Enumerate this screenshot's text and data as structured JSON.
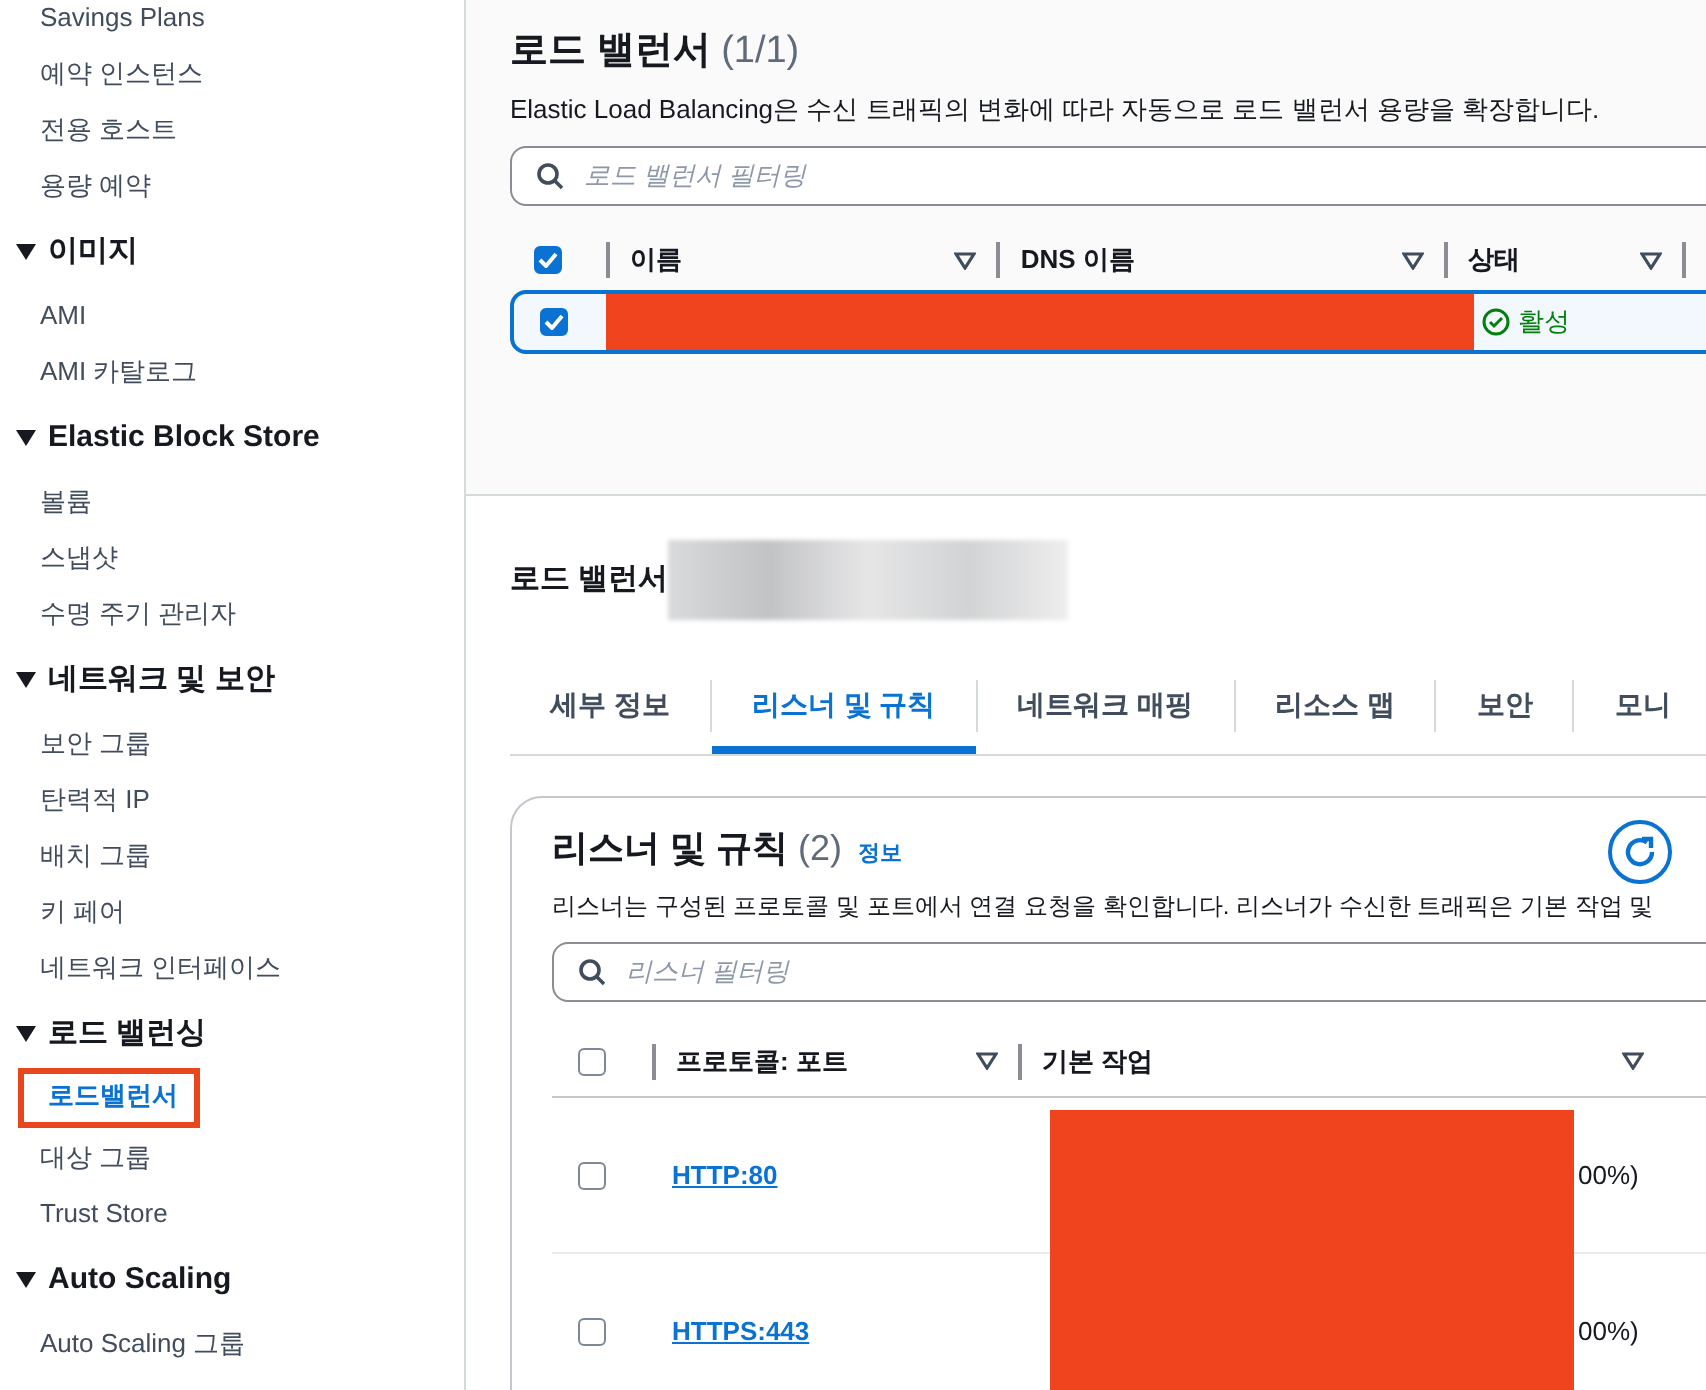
{
  "sidebar": {
    "items": [
      {
        "kind": "item",
        "label": "Savings Plans",
        "selected": false
      },
      {
        "kind": "item",
        "label": "예약 인스턴스",
        "selected": false
      },
      {
        "kind": "item",
        "label": "전용 호스트",
        "selected": false
      },
      {
        "kind": "item",
        "label": "용량 예약",
        "selected": false
      },
      {
        "kind": "header",
        "label": "이미지",
        "expanded": true
      },
      {
        "kind": "item",
        "label": "AMI",
        "selected": false
      },
      {
        "kind": "item",
        "label": "AMI 카탈로그",
        "selected": false
      },
      {
        "kind": "header",
        "label": "Elastic Block Store",
        "expanded": true
      },
      {
        "kind": "item",
        "label": "볼륨",
        "selected": false
      },
      {
        "kind": "item",
        "label": "스냅샷",
        "selected": false
      },
      {
        "kind": "item",
        "label": "수명 주기 관리자",
        "selected": false
      },
      {
        "kind": "header",
        "label": "네트워크 및 보안",
        "expanded": true
      },
      {
        "kind": "item",
        "label": "보안 그룹",
        "selected": false
      },
      {
        "kind": "item",
        "label": "탄력적 IP",
        "selected": false
      },
      {
        "kind": "item",
        "label": "배치 그룹",
        "selected": false
      },
      {
        "kind": "item",
        "label": "키 페어",
        "selected": false
      },
      {
        "kind": "item",
        "label": "네트워크 인터페이스",
        "selected": false
      },
      {
        "kind": "header",
        "label": "로드 밸런싱",
        "expanded": true
      },
      {
        "kind": "item",
        "label": "로드밸런서",
        "selected": true
      },
      {
        "kind": "item",
        "label": "대상 그룹",
        "selected": false
      },
      {
        "kind": "item",
        "label": "Trust Store",
        "selected": false
      },
      {
        "kind": "header",
        "label": "Auto Scaling",
        "expanded": true
      },
      {
        "kind": "item",
        "label": "Auto Scaling 그룹",
        "selected": false
      }
    ]
  },
  "load_balancers": {
    "title": "로드 밸런서",
    "count": "(1/1)",
    "description": "Elastic Load Balancing은 수신 트래픽의 변화에 따라 자동으로 로드 밸런서 용량을 확장합니다.",
    "filter": {
      "placeholder": "로드 밸런서 필터링"
    },
    "table": {
      "all_checked": true,
      "columns": [
        "이름",
        "DNS 이름",
        "상태"
      ],
      "rows": [
        {
          "checked": true,
          "selected": true,
          "status": "활성"
        }
      ]
    }
  },
  "details": {
    "title": "로드 밸런서",
    "tabs": [
      {
        "label": "세부 정보",
        "selected": false
      },
      {
        "label": "리스너 및 규칙",
        "selected": true
      },
      {
        "label": "네트워크 매핑",
        "selected": false
      },
      {
        "label": "리소스 맵",
        "selected": false
      },
      {
        "label": "보안",
        "selected": false
      },
      {
        "label": "모니",
        "selected": false
      }
    ],
    "listeners": {
      "title": "리스너 및 규칙",
      "count": "(2)",
      "info": "정보",
      "description": "리스너는 구성된 프로토콜 및 포트에서 연결 요청을 확인합니다. 리스너가 수신한 트래픽은 기본 작업 및",
      "filter": {
        "placeholder": "리스너 필터링"
      },
      "table": {
        "all_checked": false,
        "columns": [
          "프로토콜: 포트",
          "기본 작업"
        ],
        "rows": [
          {
            "checked": false,
            "protocol": "HTTP:80",
            "column_2": "00%)"
          },
          {
            "checked": false,
            "protocol": "HTTPS:443",
            "column_2": "00%)"
          }
        ]
      }
    }
  }
}
